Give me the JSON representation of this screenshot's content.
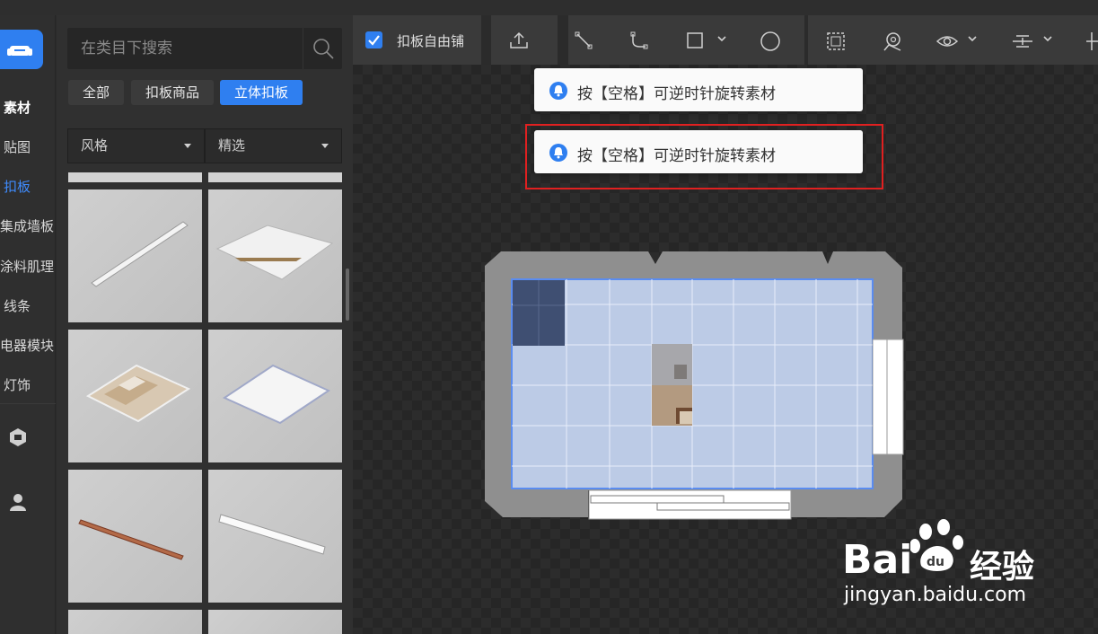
{
  "sidebar": {
    "items": [
      {
        "label": "素材"
      },
      {
        "label": "贴图"
      },
      {
        "label": "扣板"
      },
      {
        "label": "集成墙板"
      },
      {
        "label": "涂料肌理"
      },
      {
        "label": "线条"
      },
      {
        "label": "电器模块"
      },
      {
        "label": "灯饰"
      }
    ],
    "active_index": 2
  },
  "search": {
    "placeholder": "在类目下搜索"
  },
  "category_tabs": [
    {
      "label": "全部"
    },
    {
      "label": "扣板商品"
    },
    {
      "label": "立体扣板"
    }
  ],
  "active_tab": "立体扣板",
  "filters": [
    {
      "label": "风格"
    },
    {
      "label": "精选"
    }
  ],
  "toolbar": {
    "free_tile_label": "扣板自由铺",
    "free_tile_checked": true
  },
  "toasts": [
    {
      "text": "按【空格】可逆时针旋转素材"
    },
    {
      "text": "按【空格】可逆时针旋转素材"
    }
  ],
  "watermark": {
    "brand_left": "Bai",
    "brand_right": "经验",
    "url": "jingyan.baidu.com"
  },
  "colors": {
    "accent": "#2f7ff0",
    "highlight_frame": "#e02020",
    "floor_fill": "#bccbe6",
    "selected_tile": "#3f4f72"
  }
}
